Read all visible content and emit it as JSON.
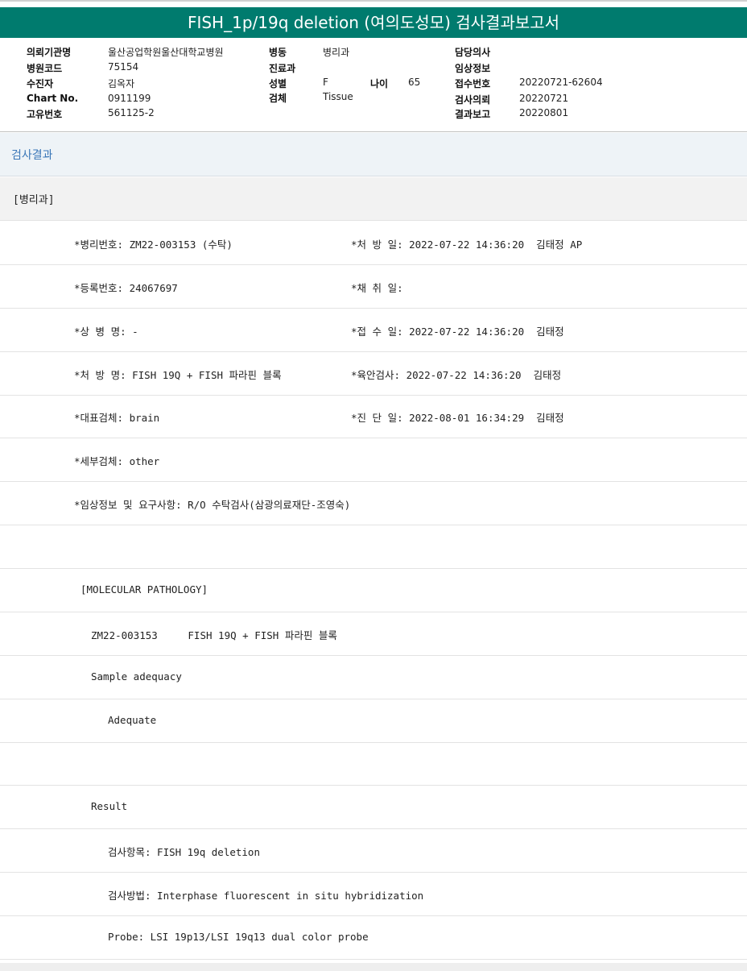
{
  "title": "FISH_1p/19q deletion (여의도성모) 검사결과보고서",
  "info": {
    "institution_label": "의뢰기관명",
    "institution_value": "울산공업학원울산대학교병원",
    "hospital_code_label": "병원코드",
    "hospital_code_value": "75154",
    "patient_label": "수진자",
    "patient_value": "김옥자",
    "chart_label": "Chart No.",
    "chart_value": "0911199",
    "unique_label": "고유번호",
    "unique_value": "561125-2",
    "ward_label": "병동",
    "ward_value": "병리과",
    "dept_label": "진료과",
    "sex_label": "성별",
    "sex_value": "F",
    "age_label": "나이",
    "age_value": "65",
    "specimen_label": "검체",
    "specimen_value": "Tissue",
    "doctor_label": "담당의사",
    "clinical_label": "임상정보",
    "receipt_label": "접수번호",
    "receipt_value": "20220721-62604",
    "request_label": "검사의뢰",
    "request_value": "20220721",
    "report_label": "결과보고",
    "report_value": "20220801"
  },
  "section_title": "검사결과",
  "sub_title": "[병리과]",
  "rows": [
    {
      "left": "*병리번호: ZM22-003153 (수탁)",
      "right": "*처 방 일: 2022-07-22 14:36:20  김태정 AP"
    },
    {
      "left": "*등록번호: 24067697",
      "right": "*채 취 일:"
    },
    {
      "left": "*상 병 명: -",
      "right": "*접 수 일: 2022-07-22 14:36:20  김태정"
    },
    {
      "left": "*처 방 명: FISH 19Q + FISH 파라핀 블록",
      "right": "*육안검사: 2022-07-22 14:36:20  김태정"
    },
    {
      "left": "*대표검체: brain",
      "right": "*진 단 일: 2022-08-01 16:34:29  김태정"
    },
    {
      "left": "*세부검체: other",
      "right": ""
    },
    {
      "left": "*임상정보 및 요구사항: R/O 수탁검사(삼광의료재단-조영숙)",
      "right": ""
    }
  ],
  "report_lines": [
    "",
    "[MOLECULAR PATHOLOGY]",
    "ZM22-003153     FISH 19Q + FISH 파라핀 블록",
    "Sample adequacy",
    "Adequate",
    "",
    "Result",
    "검사항목: FISH 19q deletion",
    "검사방법: Interphase fluorescent in situ hybridization",
    "Probe: LSI 19p13/LSI 19q13 dual color probe"
  ]
}
